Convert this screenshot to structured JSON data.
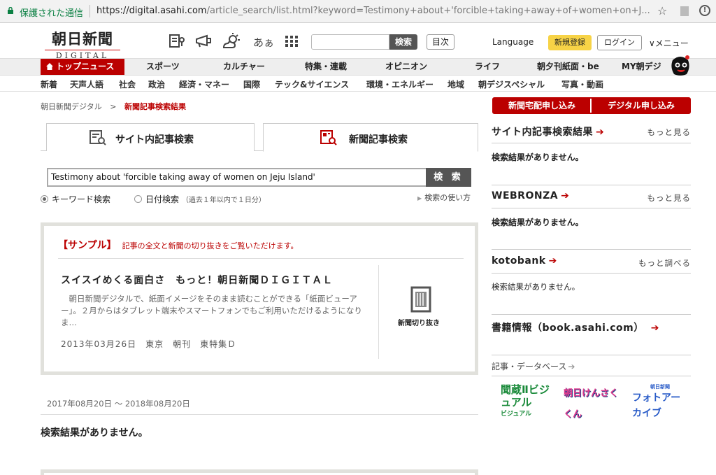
{
  "browser": {
    "secure_label": "保護された通信",
    "url_host": "https://digital.asahi.com",
    "url_path": "/article_search/list.html?keyword=Testimony+about+'forcible+taking+away+of+women+on+J..."
  },
  "header": {
    "logo_jp": "朝日新聞",
    "logo_en": "DIGITAL",
    "search_button": "検索",
    "contents_button": "目次",
    "language": "Language",
    "register": "新規登録",
    "login": "ログイン",
    "menu": "メニュー",
    "icons": [
      "newspaper-icon",
      "megaphone-icon",
      "weather-icon",
      "hiragana-icon",
      "grid-icon"
    ],
    "kana_icon_text": "あぁ"
  },
  "main_nav": {
    "items": [
      "トップニュース",
      "スポーツ",
      "カルチャー",
      "特集・連載",
      "オピニオン",
      "ライフ",
      "朝夕刊紙面・be",
      "MY朝デジ"
    ]
  },
  "sub_nav": {
    "items": [
      "新着",
      "天声人語",
      "社会",
      "政治",
      "経済・マネー",
      "国際",
      "テック&サイエンス",
      "環境・エネルギー",
      "地域",
      "朝デジスペシャル",
      "写真・動画"
    ]
  },
  "breadcrumb": {
    "home": "朝日新聞デジタル",
    "separator": ">",
    "current": "新聞記事検索結果"
  },
  "tabs": {
    "site": "サイト内記事検索",
    "news": "新聞記事検索"
  },
  "search": {
    "query": "Testimony about 'forcible taking away of women on Jeju Island'",
    "button": "検 索",
    "radio_keyword": "キーワード検索",
    "radio_date": "日付検索",
    "radio_date_note": "（過去１年以内で１日分）",
    "howto": "検索の使い方"
  },
  "sample": {
    "tag": "【サンプル】",
    "desc": "記事の全文と新聞の切り抜きをご覧いただけます。",
    "title": "スイスイめくる面白さ　もっと！朝日新聞ＤＩＧＩＴＡＬ",
    "body": "　朝日新聞デジタルで、紙面イメージをそのまま読むことができる「紙面ビューアー」。２月からはタブレット端末やスマートフォンでもご利用いただけるようになりま…",
    "meta": "2013年03月26日　東京　朝刊　東特集Ｄ",
    "clip_label": "新聞切り抜き"
  },
  "results": {
    "date_range": "2017年08月20日 ～ 2018年08月20日",
    "no_results": "検索結果がありません。"
  },
  "sidebar": {
    "delivery_button": "新聞宅配申し込み",
    "digital_button": "デジタル申し込み",
    "sections": [
      {
        "title": "サイト内記事検索結果",
        "more": "もっと見る",
        "empty": "検索結果がありません。"
      },
      {
        "title": "WEBRONZA",
        "more": "もっと見る",
        "empty": "検索結果がありません。"
      },
      {
        "title": "kotobank",
        "more": "もっと調べる",
        "empty": "検索結果がありません。"
      },
      {
        "title": "書籍情報（book.asahi.com）",
        "more": "",
        "empty": ""
      }
    ],
    "db_title": "記事・データベース",
    "db_logos": [
      "聞蔵Ⅱビジュアル",
      "朝日けんさくくん",
      "フォトアーカイブ"
    ],
    "db_logo_captions": [
      "ビジュアル",
      "朝日新聞"
    ]
  },
  "colors": {
    "brand_red": "#b00000",
    "nav_gray": "#eeeeee",
    "button_dark": "#555555",
    "register_yellow": "#f7d346"
  }
}
